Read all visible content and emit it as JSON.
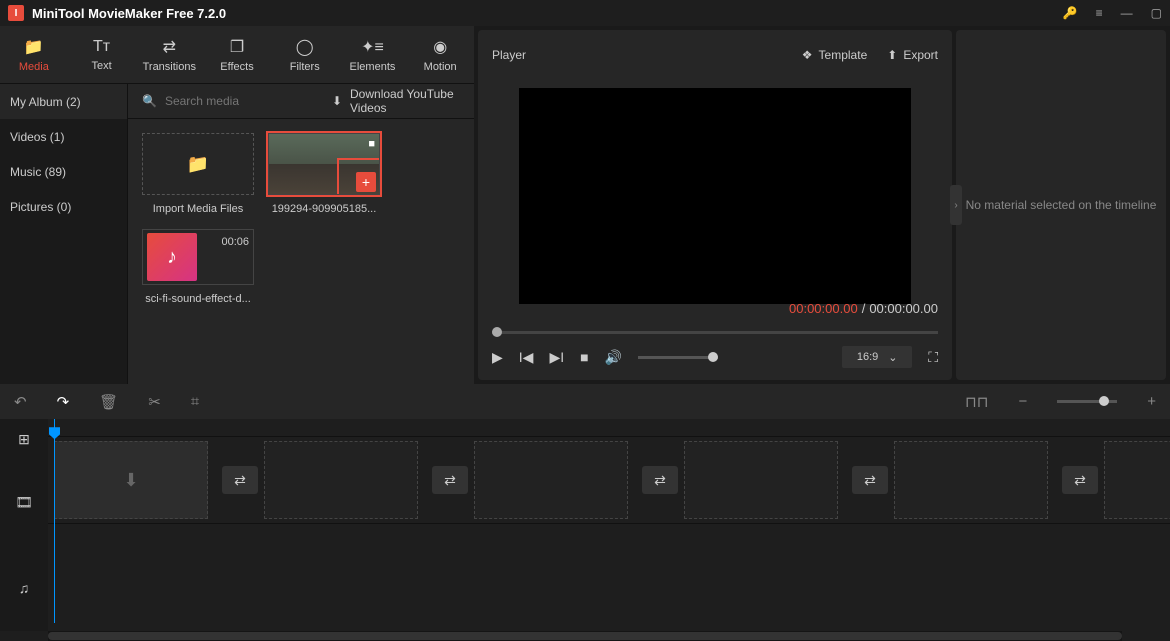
{
  "titlebar": {
    "app_name": "MiniTool MovieMaker Free 7.2.0"
  },
  "tabs": {
    "media": "Media",
    "text": "Text",
    "transitions": "Transitions",
    "effects": "Effects",
    "filters": "Filters",
    "elements": "Elements",
    "motion": "Motion"
  },
  "sidebar": {
    "my_album": "My Album (2)",
    "videos": "Videos (1)",
    "music": "Music (89)",
    "pictures": "Pictures (0)"
  },
  "media": {
    "search_placeholder": "Search media",
    "download_label": "Download YouTube Videos",
    "import_label": "Import Media Files",
    "clip1_name": "199294-909905185...",
    "clip2_name": "sci-fi-sound-effect-d...",
    "clip2_duration": "00:06"
  },
  "player": {
    "title": "Player",
    "template": "Template",
    "export": "Export",
    "time_current": "00:00:00.00",
    "time_sep": "/",
    "time_total": "00:00:00.00",
    "aspect": "16:9"
  },
  "inspector": {
    "empty_msg": "No material selected on the timeline"
  }
}
